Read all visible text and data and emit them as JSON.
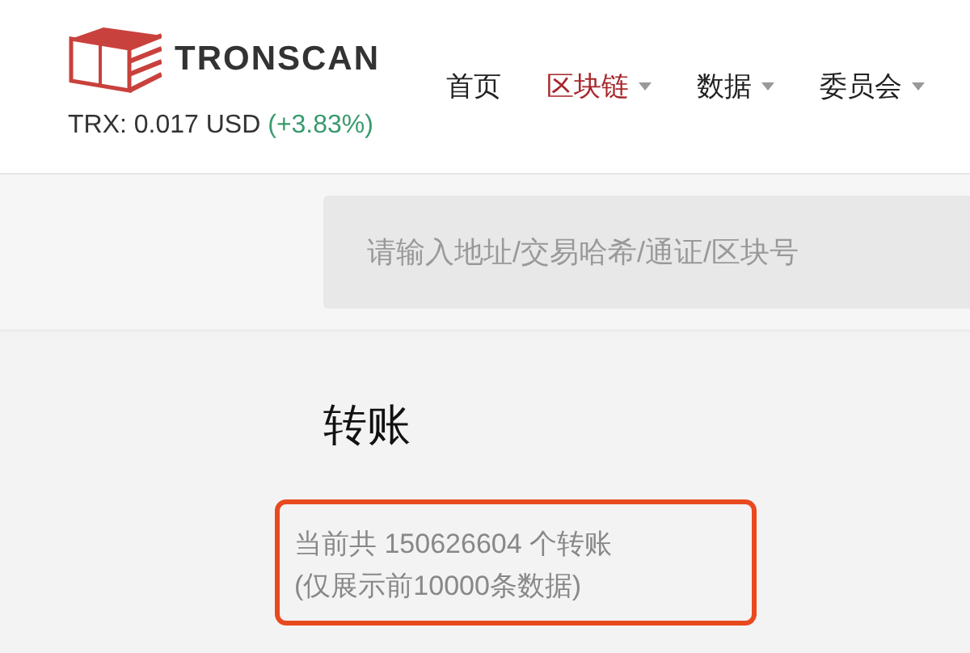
{
  "header": {
    "brand": "TRONSCAN",
    "price": {
      "label": "TRX: 0.017 USD",
      "change": "(+3.83%)"
    },
    "nav": [
      {
        "label": "首页",
        "selected": false,
        "dropdown": false
      },
      {
        "label": "区块链",
        "selected": true,
        "dropdown": true
      },
      {
        "label": "数据",
        "selected": false,
        "dropdown": true
      },
      {
        "label": "委员会",
        "selected": false,
        "dropdown": true
      }
    ]
  },
  "search": {
    "placeholder": "请输入地址/交易哈希/通证/区块号"
  },
  "page": {
    "title": "转账",
    "summary": [
      "当前共 150626604 个转账",
      "(仅展示前10000条数据)"
    ],
    "highlighted": true
  }
}
